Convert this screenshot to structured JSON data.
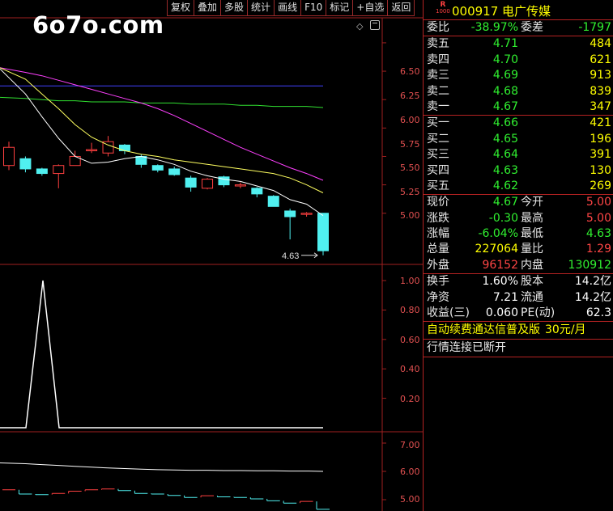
{
  "toolbar": {
    "items": [
      "复权",
      "叠加",
      "多股",
      "统计",
      "画线",
      "F10",
      "标记",
      "+自选",
      "返回"
    ]
  },
  "watermark": "6o7o.com",
  "chart": {
    "colors": {
      "up": "#ff4040",
      "down": "#50f0f0",
      "ma5": "#ffffff",
      "ma10": "#ffff60",
      "ma20": "#ff40ff",
      "ma60": "#30e030",
      "ma120": "#4040ff",
      "grid": "#a02020"
    },
    "price_axis": [
      "6.50",
      "6.25",
      "6.00",
      "5.75",
      "5.50",
      "5.25",
      "5.00"
    ],
    "low_marker": "4.63",
    "indicator_axis": [
      "1.00",
      "0.80",
      "0.60",
      "0.40",
      "0.20"
    ],
    "lower_axis": [
      "7.00",
      "6.00",
      "5.00"
    ]
  },
  "chart_data": {
    "type": "candlestick",
    "price_range": [
      4.55,
      6.72
    ],
    "candles": [
      {
        "o": 5.42,
        "h": 5.63,
        "l": 5.38,
        "c": 5.58
      },
      {
        "o": 5.48,
        "h": 5.5,
        "l": 5.36,
        "c": 5.39
      },
      {
        "o": 5.39,
        "h": 5.4,
        "l": 5.33,
        "c": 5.35
      },
      {
        "o": 5.35,
        "h": 5.43,
        "l": 5.22,
        "c": 5.42
      },
      {
        "o": 5.42,
        "h": 5.55,
        "l": 5.42,
        "c": 5.5
      },
      {
        "o": 5.55,
        "h": 5.62,
        "l": 5.53,
        "c": 5.56
      },
      {
        "o": 5.53,
        "h": 5.68,
        "l": 5.5,
        "c": 5.63
      },
      {
        "o": 5.6,
        "h": 5.61,
        "l": 5.52,
        "c": 5.55
      },
      {
        "o": 5.5,
        "h": 5.52,
        "l": 5.4,
        "c": 5.43
      },
      {
        "o": 5.42,
        "h": 5.43,
        "l": 5.36,
        "c": 5.38
      },
      {
        "o": 5.39,
        "h": 5.41,
        "l": 5.33,
        "c": 5.34
      },
      {
        "o": 5.31,
        "h": 5.33,
        "l": 5.19,
        "c": 5.23
      },
      {
        "o": 5.22,
        "h": 5.31,
        "l": 5.21,
        "c": 5.3
      },
      {
        "o": 5.32,
        "h": 5.33,
        "l": 5.23,
        "c": 5.25
      },
      {
        "o": 5.24,
        "h": 5.27,
        "l": 5.22,
        "c": 5.25
      },
      {
        "o": 5.22,
        "h": 5.23,
        "l": 5.14,
        "c": 5.17
      },
      {
        "o": 5.15,
        "h": 5.16,
        "l": 5.06,
        "c": 5.06
      },
      {
        "o": 5.02,
        "h": 5.04,
        "l": 4.77,
        "c": 4.97
      },
      {
        "o": 4.99,
        "h": 5.01,
        "l": 4.97,
        "c": 5.0
      },
      {
        "o": 5.0,
        "h": 5.0,
        "l": 4.63,
        "c": 4.67
      }
    ],
    "ma": {
      "ma5": [
        6.27,
        6.05,
        5.85,
        5.66,
        5.5,
        5.44,
        5.45,
        5.48,
        5.5,
        5.47,
        5.43,
        5.37,
        5.33,
        5.3,
        5.28,
        5.24,
        5.2,
        5.12,
        5.08,
        4.98
      ],
      "ma10": [
        6.28,
        6.18,
        6.05,
        5.92,
        5.78,
        5.67,
        5.6,
        5.55,
        5.52,
        5.5,
        5.47,
        5.45,
        5.43,
        5.41,
        5.39,
        5.37,
        5.35,
        5.31,
        5.25,
        5.18
      ],
      "ma20": [
        6.28,
        6.24,
        6.21,
        6.17,
        6.13,
        6.09,
        6.05,
        6.01,
        5.97,
        5.92,
        5.86,
        5.79,
        5.72,
        5.65,
        5.58,
        5.52,
        5.46,
        5.4,
        5.35,
        5.29
      ],
      "ma60": [
        6.02,
        6.01,
        6.0,
        5.99,
        5.99,
        5.98,
        5.98,
        5.98,
        5.97,
        5.97,
        5.97,
        5.96,
        5.96,
        5.96,
        5.95,
        5.95,
        5.94,
        5.94,
        5.94,
        5.93
      ],
      "ma120": [
        6.12,
        6.12,
        6.12,
        6.12,
        6.12,
        6.12,
        6.12,
        6.12,
        6.12,
        6.12,
        6.12,
        6.12,
        6.12,
        6.12,
        6.12,
        6.12,
        6.12,
        6.12,
        6.12,
        6.12
      ]
    },
    "indicator": [
      0,
      0,
      0,
      1,
      0,
      0,
      0,
      0,
      0,
      0,
      0,
      0,
      0,
      0,
      0,
      0,
      0,
      0,
      0,
      0
    ],
    "lower_line": [
      6.3,
      6.27,
      6.24,
      6.21,
      6.18,
      6.15,
      6.12,
      6.1,
      6.08,
      6.06,
      6.05,
      6.04,
      6.04,
      6.03,
      6.03,
      6.02,
      6.02,
      6.01,
      6.01,
      6.0
    ],
    "lower_steps": [
      5.35,
      5.2,
      5.18,
      5.22,
      5.3,
      5.35,
      5.38,
      5.32,
      5.22,
      5.2,
      5.15,
      5.08,
      5.14,
      5.1,
      5.08,
      5.03,
      4.96,
      4.88,
      4.94,
      4.66
    ]
  },
  "quote": {
    "badge_top": "R",
    "badge_bottom": "1000",
    "code_name": "000917 电广传媒",
    "weibi": {
      "label": "委比",
      "value": "-38.97%",
      "label2": "委差",
      "value2": "-1797"
    },
    "asks": [
      {
        "label": "卖五",
        "price": "4.71",
        "vol": "484"
      },
      {
        "label": "卖四",
        "price": "4.70",
        "vol": "621"
      },
      {
        "label": "卖三",
        "price": "4.69",
        "vol": "913"
      },
      {
        "label": "卖二",
        "price": "4.68",
        "vol": "839"
      },
      {
        "label": "卖一",
        "price": "4.67",
        "vol": "347"
      }
    ],
    "bids": [
      {
        "label": "买一",
        "price": "4.66",
        "vol": "421"
      },
      {
        "label": "买二",
        "price": "4.65",
        "vol": "196"
      },
      {
        "label": "买三",
        "price": "4.64",
        "vol": "391"
      },
      {
        "label": "买四",
        "price": "4.63",
        "vol": "130"
      },
      {
        "label": "买五",
        "price": "4.62",
        "vol": "269"
      }
    ],
    "stats": [
      {
        "l1": "现价",
        "v1": "4.67",
        "c1": "green",
        "l2": "今开",
        "v2": "5.00",
        "c2": "red"
      },
      {
        "l1": "涨跌",
        "v1": "-0.30",
        "c1": "green",
        "l2": "最高",
        "v2": "5.00",
        "c2": "red"
      },
      {
        "l1": "涨幅",
        "v1": "-6.04%",
        "c1": "green",
        "l2": "最低",
        "v2": "4.63",
        "c2": "green"
      },
      {
        "l1": "总量",
        "v1": "227064",
        "c1": "yellow",
        "l2": "量比",
        "v2": "1.29",
        "c2": "red"
      },
      {
        "l1": "外盘",
        "v1": "96152",
        "c1": "red",
        "l2": "内盘",
        "v2": "130912",
        "c2": "green"
      }
    ],
    "fund": [
      {
        "l1": "换手",
        "v1": "1.60%",
        "l2": "股本",
        "v2": "14.2亿"
      },
      {
        "l1": "净资",
        "v1": "7.21",
        "l2": "流通",
        "v2": "14.2亿"
      },
      {
        "l1": "收益(三)",
        "v1": "0.060",
        "l2": "PE(动)",
        "v2": "62.3"
      }
    ],
    "ad_text": "自动续费通达信普及版",
    "ad_price": "30元/月",
    "status": "行情连接已断开"
  }
}
